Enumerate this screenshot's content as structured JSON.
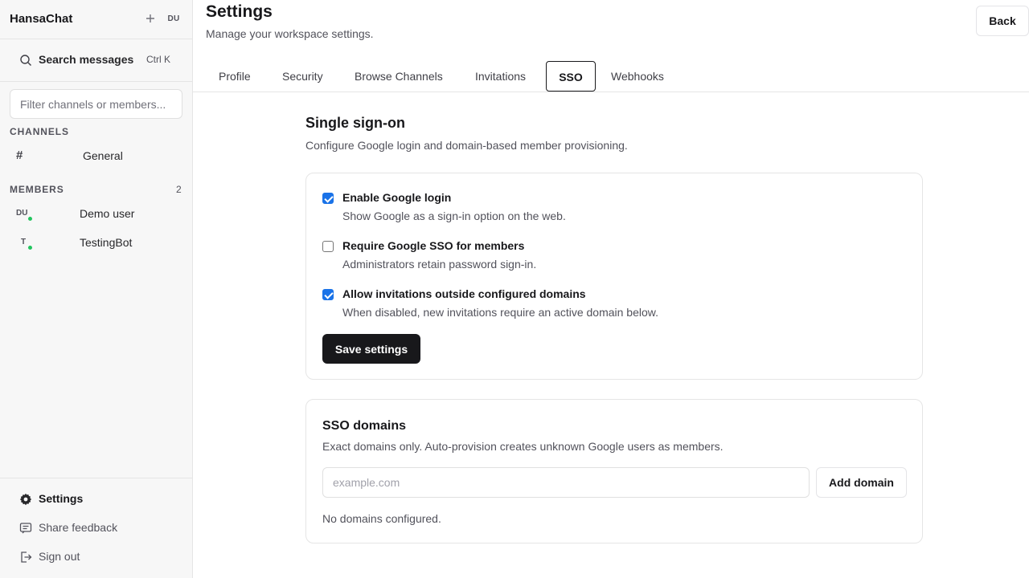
{
  "sidebar": {
    "app_name": "HansaChat",
    "header_avatar": "DU",
    "search": {
      "label": "Search messages",
      "shortcut": "Ctrl K"
    },
    "filter": {
      "placeholder": "Filter channels or members..."
    },
    "channels_label": "CHANNELS",
    "channels": [
      {
        "icon": "#",
        "name": "General"
      }
    ],
    "members_label": "MEMBERS",
    "members_count": "2",
    "members": [
      {
        "initials": "DU",
        "name": "Demo user",
        "status": "online"
      },
      {
        "initials": "T",
        "name": "TestingBot",
        "status": "online"
      }
    ],
    "footer": {
      "settings": "Settings",
      "feedback": "Share feedback",
      "signout": "Sign out"
    }
  },
  "header": {
    "title": "Settings",
    "subtitle": "Manage your workspace settings.",
    "back_label": "Back"
  },
  "tabs": [
    {
      "label": "Profile"
    },
    {
      "label": "Security"
    },
    {
      "label": "Browse Channels"
    },
    {
      "label": "Invitations"
    },
    {
      "label": "SSO",
      "active": true
    },
    {
      "label": "Webhooks"
    }
  ],
  "sso": {
    "title": "Single sign-on",
    "description": "Configure Google login and domain-based member provisioning.",
    "options": [
      {
        "label": "Enable Google login",
        "desc": "Show Google as a sign-in option on the web.",
        "checked": true
      },
      {
        "label": "Require Google SSO for members",
        "desc": "Administrators retain password sign-in.",
        "checked": false
      },
      {
        "label": "Allow invitations outside configured domains",
        "desc": "When disabled, new invitations require an active domain below.",
        "checked": true
      }
    ],
    "save_label": "Save settings"
  },
  "domains": {
    "title": "SSO domains",
    "description": "Exact domains only. Auto-provision creates unknown Google users as members.",
    "input_placeholder": "example.com",
    "input_value": "",
    "add_label": "Add domain",
    "empty_text": "No domains configured."
  },
  "colors": {
    "accent": "#18181b",
    "checkbox": "#1a73e8",
    "online": "#22c55e"
  }
}
